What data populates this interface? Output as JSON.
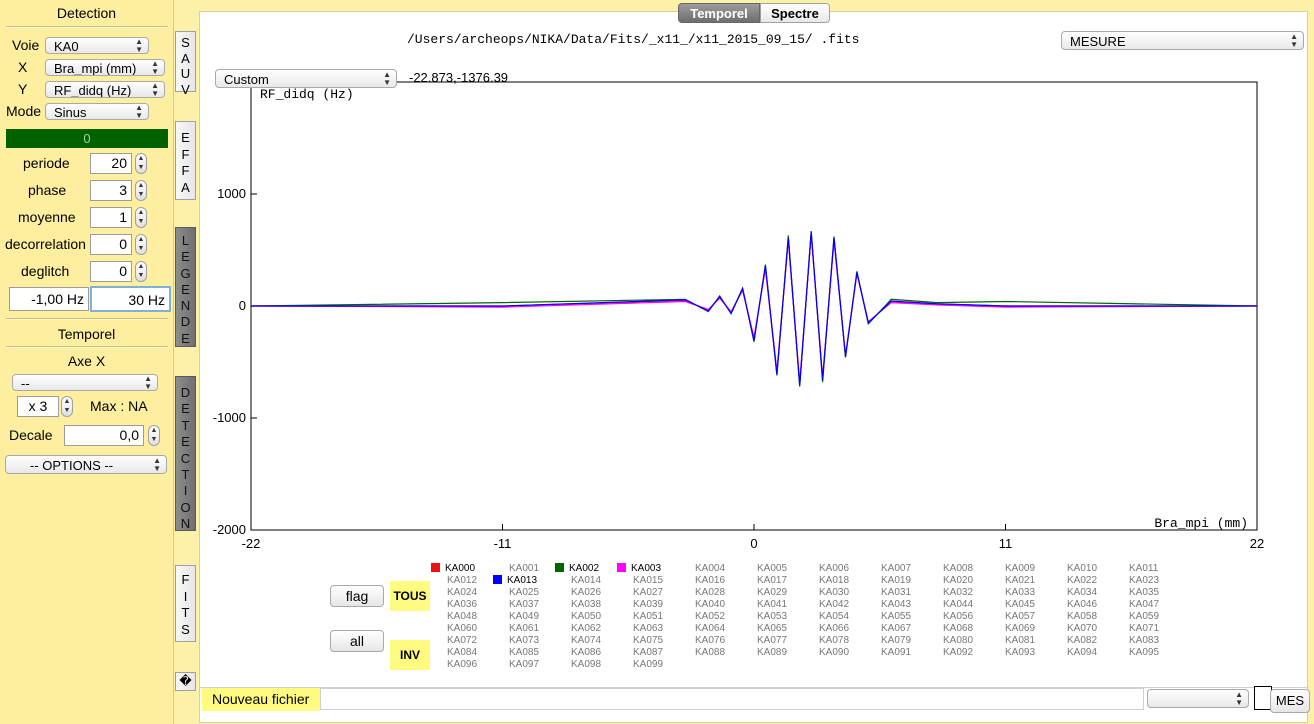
{
  "left": {
    "title": "Detection",
    "voie": {
      "label": "Voie",
      "value": "KA0"
    },
    "x": {
      "label": "X",
      "value": "Bra_mpi (mm)"
    },
    "y": {
      "label": "Y",
      "value": "RF_didq (Hz)"
    },
    "mode": {
      "label": "Mode",
      "value": "Sinus"
    },
    "status_value": "0",
    "periode": {
      "label": "periode",
      "value": "20"
    },
    "phase": {
      "label": "phase",
      "value": "3"
    },
    "moyenne": {
      "label": "moyenne",
      "value": "1"
    },
    "decorrelation": {
      "label": "decorrelation",
      "value": "0"
    },
    "deglitch": {
      "label": "deglitch",
      "value": "0"
    },
    "freq_low": "-1,00 Hz",
    "freq_high": "30 Hz",
    "temporel_title": "Temporel",
    "axe_x_title": "Axe X",
    "axe_x_select": "--",
    "multiplier": "x 3",
    "max_label": "Max : NA",
    "decale": {
      "label": "Decale",
      "value": "0,0"
    },
    "options": "-- OPTIONS --"
  },
  "vtabs": {
    "sauv": [
      "S",
      "A",
      "U",
      "V"
    ],
    "effa": [
      "E",
      "F",
      "F",
      "A"
    ],
    "legende": [
      "L",
      "E",
      "G",
      "E",
      "N",
      "D",
      "E"
    ],
    "detection": [
      "D",
      "E",
      "T",
      "E",
      "C",
      "T",
      "I",
      "O",
      "N"
    ],
    "fits": [
      "F",
      "I",
      "T",
      "S"
    ],
    "unknown": "�"
  },
  "main": {
    "tab_temporel": "Temporel",
    "tab_spectre": "Spectre",
    "file_path": "/Users/archeops/NIKA/Data/Fits/_x11_/x11_2015_09_15/ .fits",
    "mesure_select": "MESURE",
    "custom_select": "Custom",
    "coords": "-22.873,-1376.39",
    "flag_button": "flag",
    "all_button": "all",
    "tous_badge": "TOUS",
    "inv_badge": "INV",
    "nouveau_fichier": "Nouveau fichier",
    "nouveau_value": "",
    "bottom_select": "",
    "mes_button": "MES"
  },
  "legend": {
    "rows": [
      [
        "KA000",
        "KA001",
        "KA002",
        "KA003",
        "KA004",
        "KA005",
        "KA006",
        "KA007",
        "KA008",
        "KA009",
        "KA010",
        "KA011"
      ],
      [
        "KA012",
        "KA013",
        "KA014",
        "KA015",
        "KA016",
        "KA017",
        "KA018",
        "KA019",
        "KA020",
        "KA021",
        "KA022",
        "KA023"
      ],
      [
        "KA024",
        "KA025",
        "KA026",
        "KA027",
        "KA028",
        "KA029",
        "KA030",
        "KA031",
        "KA032",
        "KA033",
        "KA034",
        "KA035"
      ],
      [
        "KA036",
        "KA037",
        "KA038",
        "KA039",
        "KA040",
        "KA041",
        "KA042",
        "KA043",
        "KA044",
        "KA045",
        "KA046",
        "KA047"
      ],
      [
        "KA048",
        "KA049",
        "KA050",
        "KA051",
        "KA052",
        "KA053",
        "KA054",
        "KA055",
        "KA056",
        "KA057",
        "KA058",
        "KA059"
      ],
      [
        "KA060",
        "KA061",
        "KA062",
        "KA063",
        "KA064",
        "KA065",
        "KA066",
        "KA067",
        "KA068",
        "KA069",
        "KA070",
        "KA071"
      ],
      [
        "KA072",
        "KA073",
        "KA074",
        "KA075",
        "KA076",
        "KA077",
        "KA078",
        "KA079",
        "KA080",
        "KA081",
        "KA082",
        "KA083"
      ],
      [
        "KA084",
        "KA085",
        "KA086",
        "KA087",
        "KA088",
        "KA089",
        "KA090",
        "KA091",
        "KA092",
        "KA093",
        "KA094",
        "KA095"
      ],
      [
        "KA096",
        "KA097",
        "KA098",
        "KA099"
      ]
    ],
    "active": {
      "KA000": "#ee1111",
      "KA002": "#006400",
      "KA003": "#ff00ff",
      "KA013": "#0000ff"
    }
  },
  "chart_data": {
    "type": "line",
    "xlabel": "Bra_mpi (mm)",
    "ylabel": "RF_didq (Hz)",
    "xlim": [
      -22,
      22
    ],
    "ylim": [
      -2000,
      2000
    ],
    "x_ticks": [
      "-22",
      "-11",
      "0",
      "11",
      "22"
    ],
    "y_ticks": [
      "1000",
      "0",
      "-1000",
      "-2000"
    ],
    "grid": false,
    "series": [
      {
        "name": "KA000",
        "color": "#ee1111",
        "x": [
          -22,
          -11,
          -3,
          -2,
          -1.5,
          -1,
          -0.5,
          0,
          0.5,
          1,
          1.5,
          2,
          2.5,
          3,
          3.5,
          4,
          4.5,
          5,
          6,
          8,
          11,
          22
        ],
        "y": [
          0,
          0,
          50,
          -40,
          80,
          -60,
          150,
          -300,
          350,
          -600,
          600,
          -700,
          650,
          -650,
          600,
          -450,
          300,
          -150,
          40,
          20,
          0,
          0
        ]
      },
      {
        "name": "KA002",
        "color": "#006400",
        "x": [
          -22,
          -11,
          -3,
          -2,
          -1.5,
          -1,
          -0.5,
          0,
          0.5,
          1,
          1.5,
          2,
          2.5,
          3,
          3.5,
          4,
          4.5,
          5,
          6,
          8,
          11,
          22
        ],
        "y": [
          0,
          30,
          60,
          -50,
          90,
          -70,
          160,
          -320,
          370,
          -620,
          630,
          -720,
          670,
          -680,
          620,
          -460,
          310,
          -160,
          60,
          30,
          40,
          0
        ]
      },
      {
        "name": "KA003",
        "color": "#ff00ff",
        "x": [
          -22,
          -11,
          -3,
          -2,
          -1.5,
          -1,
          -0.5,
          0,
          0.5,
          1,
          1.5,
          2,
          2.5,
          3,
          3.5,
          4,
          4.5,
          5,
          6,
          8,
          11,
          22
        ],
        "y": [
          0,
          -10,
          40,
          -30,
          70,
          -50,
          140,
          -280,
          330,
          -580,
          590,
          -680,
          640,
          -640,
          580,
          -440,
          290,
          -140,
          30,
          10,
          -10,
          0
        ]
      },
      {
        "name": "KA013",
        "color": "#0000ff",
        "x": [
          -22,
          -11,
          -3,
          -2,
          -1.5,
          -1,
          -0.5,
          0,
          0.5,
          1,
          1.5,
          2,
          2.5,
          3,
          3.5,
          4,
          4.5,
          5,
          6,
          8,
          11,
          22
        ],
        "y": [
          0,
          0,
          55,
          -45,
          85,
          -65,
          155,
          -310,
          360,
          -610,
          610,
          -710,
          660,
          -660,
          610,
          -450,
          300,
          -150,
          45,
          20,
          0,
          0
        ]
      }
    ]
  }
}
